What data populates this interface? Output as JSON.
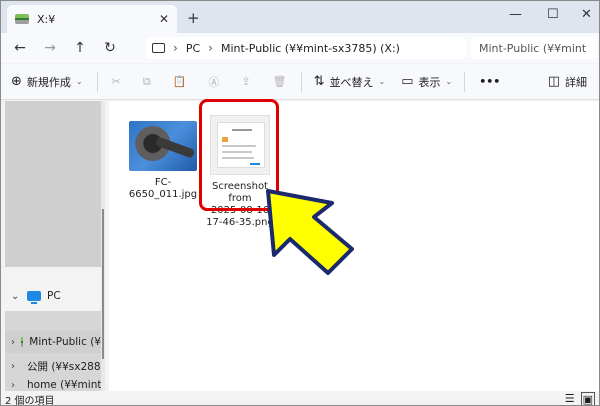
{
  "tab": {
    "title": "X:¥",
    "close": "✕"
  },
  "window": {
    "new_tab": "+",
    "minimize": "—",
    "maximize": "☐",
    "close": "✕"
  },
  "nav": {
    "back": "←",
    "forward": "→",
    "up": "↑",
    "refresh": "↻"
  },
  "address": {
    "crumbs": [
      "PC",
      "Mint-Public (¥¥mint-sx3785) (X:)"
    ]
  },
  "search": {
    "text": "Mint-Public (¥¥mint"
  },
  "command_bar": {
    "new_label": "新規作成",
    "sort_label": "並べ替え",
    "view_label": "表示",
    "more": "•••",
    "details_label": "詳細"
  },
  "nav_pane": {
    "pc_label": "PC",
    "items": [
      {
        "label": "Mint-Public (¥"
      },
      {
        "label": "公開 (¥¥sx2885"
      },
      {
        "label": "home (¥¥mint"
      }
    ]
  },
  "files": [
    {
      "name": "FC-6650_011.jpg"
    },
    {
      "name_lines": [
        "Screenshot from",
        "2025-08-16",
        "17-46-35.png"
      ]
    }
  ],
  "status": {
    "count": "2 個の項目"
  },
  "colors": {
    "highlight": "#e00000",
    "arrow_fill": "#ffff00",
    "arrow_stroke": "#1a2a6c"
  }
}
